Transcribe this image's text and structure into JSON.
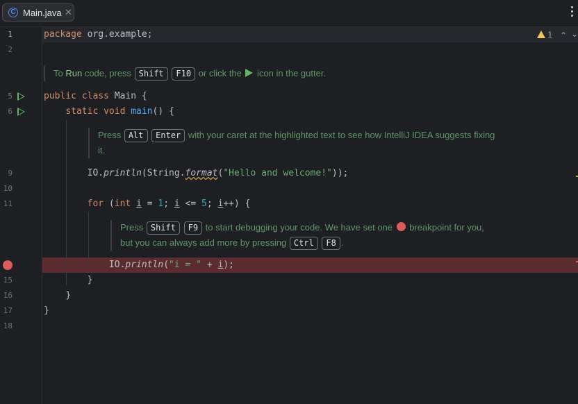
{
  "tabs": [
    {
      "label": "Main.java",
      "icon": "C"
    }
  ],
  "inspection": {
    "warning_count": "1"
  },
  "line_numbers": [
    "1",
    "2",
    "5",
    "6",
    "9",
    "10",
    "11",
    "",
    "15",
    "16",
    "17",
    "18"
  ],
  "code": {
    "l1_kw": "package",
    "l1_rest": " org.example;",
    "l5_kw": "public class",
    "l5_rest": " Main {",
    "l6_kw": "static void",
    "l6_fn": "main",
    "l6_rest": "() {",
    "l9_a": "IO.",
    "l9_b": "println",
    "l9_c": "(String.",
    "l9_d": "format",
    "l9_e": "(",
    "l9_str": "\"Hello and welcome!\"",
    "l9_f": "));",
    "l11_kw": "for",
    "l11_a": " (",
    "l11_int": "int",
    "l11_b": " ",
    "l11_i1": "i",
    "l11_c": " = ",
    "l11_n1": "1",
    "l11_d": "; ",
    "l11_i2": "i",
    "l11_e": " <= ",
    "l11_n5": "5",
    "l11_f": "; ",
    "l11_i3": "i",
    "l11_g": "++) {",
    "l14_a": "IO.",
    "l14_b": "println",
    "l14_c": "(",
    "l14_str": "\"i = \"",
    "l14_d": " + ",
    "l14_i": "i",
    "l14_e": ");",
    "l15": "}",
    "l16": "}",
    "l17": "}"
  },
  "doc1": {
    "t1": "To ",
    "run": "Run",
    "t2": " code, press ",
    "k1": "Shift",
    "k2": "F10",
    "t3": " or click the ",
    "t4": " icon in the gutter."
  },
  "doc2": {
    "t1": "Press ",
    "k1": "Alt",
    "k2": "Enter",
    "t2": " with your caret at the highlighted text to see how IntelliJ IDEA suggests fixing",
    "t3": "it."
  },
  "doc3": {
    "t1": "Press ",
    "k1": "Shift",
    "k2": "F9",
    "t2": " to start debugging your code. We have set one ",
    "t3": " breakpoint for you,",
    "t4": "but you can always add more by pressing ",
    "k3": "Ctrl",
    "k4": "F8",
    "t5": "."
  },
  "colors": {
    "keyword": "#cf8e6d",
    "function": "#56a8f5",
    "string": "#6aab73",
    "number": "#2aacb8",
    "breakpoint": "#db5c5c",
    "run": "#5fb865"
  }
}
